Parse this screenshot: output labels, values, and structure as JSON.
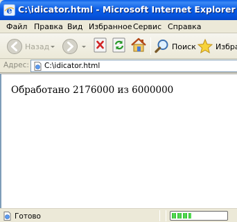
{
  "window": {
    "title": "C:\\idicator.html - Microsoft Internet Explorer"
  },
  "menu": {
    "items": [
      "Файл",
      "Правка",
      "Вид",
      "Избранное",
      "Сервис",
      "Справка"
    ]
  },
  "toolbar": {
    "back_label": "Назад",
    "search_label": "Поиск",
    "favorites_label": "Избран"
  },
  "address": {
    "label": "Адрес:",
    "value": "C:\\idicator.html"
  },
  "page": {
    "text": "Обработано 2176000 из 6000000",
    "processed": 2176000,
    "total": 6000000
  },
  "status": {
    "text": "Готово",
    "progress_fraction": 0.362
  },
  "colors": {
    "titlebar": "#0553dd",
    "progress": "#2fbb2f",
    "chrome": "#ece9d8"
  }
}
